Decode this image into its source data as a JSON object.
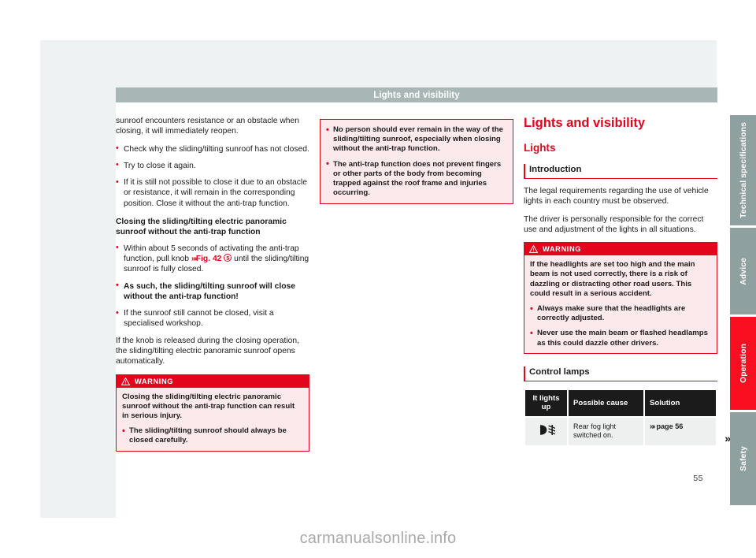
{
  "header": {
    "title": "Lights and visibility"
  },
  "page_number": "55",
  "watermark": "carmanualsonline.info",
  "colors": {
    "brand_red": "#e3051b",
    "header_bar": "#a8b6b6",
    "tab_gray": "#8ea0a0",
    "tab_active": "#fa0f21",
    "warning_bg": "#fce9ec",
    "table_header": "#1b1b1b",
    "table_cell": "#eef0f0"
  },
  "left_column": {
    "intro": "sunroof encounters resistance or an obstacle when closing, it will immediately reopen.",
    "bullets_1": [
      {
        "text": "Check why the sliding/tilting sunroof has not closed.",
        "bold": false
      },
      {
        "text": "Try to close it again.",
        "bold": false
      },
      {
        "text": "If it is still not possible to close it due to an obstacle or resistance, it will remain in the corresponding position. Close it without the anti-trap function.",
        "bold": false
      }
    ],
    "subhead": "Closing the sliding/tilting electric panoramic sunroof without the anti-trap function",
    "bullet_ref": {
      "before": "Within about 5 seconds of activating the anti-trap function, pull knob ",
      "arrows": "»›",
      "fig": "Fig. 42",
      "circle_number": "5",
      "after": " until the sliding/tilting sunroof is fully closed."
    },
    "bullets_2": [
      {
        "text": "As such, the sliding/tilting sunroof will close without the anti-trap function!",
        "bold": true
      },
      {
        "text": "If the sunroof still cannot be closed, visit a specialised workshop.",
        "bold": false
      }
    ],
    "closing_para": "If the knob is released during the closing operation, the sliding/tilting electric panoramic sunroof opens automatically.",
    "warning": {
      "icon": "warning-triangle-icon",
      "title": "WARNING",
      "paragraphs": [
        "Closing the sliding/tilting electric panoramic sunroof without the anti-trap function can result in serious injury."
      ],
      "bullets": [
        "The sliding/tilting sunroof should always be closed carefully."
      ]
    }
  },
  "middle_column": {
    "warning": {
      "bullets": [
        "No person should ever remain in the way of the sliding/tilting sunroof, especially when closing without the anti-trap function.",
        "The anti-trap function does not prevent fingers or other parts of the body from becoming trapped against the roof frame and injuries occurring."
      ]
    }
  },
  "right_column": {
    "chapter_title": "Lights and visibility",
    "section_title": "Lights",
    "topic_title": "Introduction",
    "paragraphs": [
      "The legal requirements regarding the use of vehicle lights in each country must be observed.",
      "The driver is personally responsible for the correct use and adjustment of the lights in all situations."
    ],
    "warning": {
      "icon": "warning-triangle-icon",
      "title": "WARNING",
      "paragraphs": [
        "If the headlights are set too high and the main beam is not used correctly, there is a risk of dazzling or distracting other road users. This could result in a serious accident."
      ],
      "bullets": [
        "Always make sure that the headlights are correctly adjusted.",
        "Never use the main beam or flashed headlamps as this could dazzle other drivers."
      ]
    },
    "control_lamps": {
      "topic_title": "Control lamps",
      "columns": [
        "It lights up",
        "Possible cause",
        "Solution"
      ],
      "rows": [
        {
          "symbol": "rear-fog-light-icon",
          "cause": "Rear fog light switched on.",
          "solution_arrows": "»›",
          "solution": "page 56"
        }
      ],
      "continuation_marker": "»"
    }
  },
  "side_tabs": [
    {
      "label": "Technical specifications",
      "active": false,
      "height": 140
    },
    {
      "label": "Advice",
      "active": false,
      "height": 110
    },
    {
      "label": "Operation",
      "active": true,
      "height": 118
    },
    {
      "label": "Safety",
      "active": false,
      "height": 118
    }
  ]
}
